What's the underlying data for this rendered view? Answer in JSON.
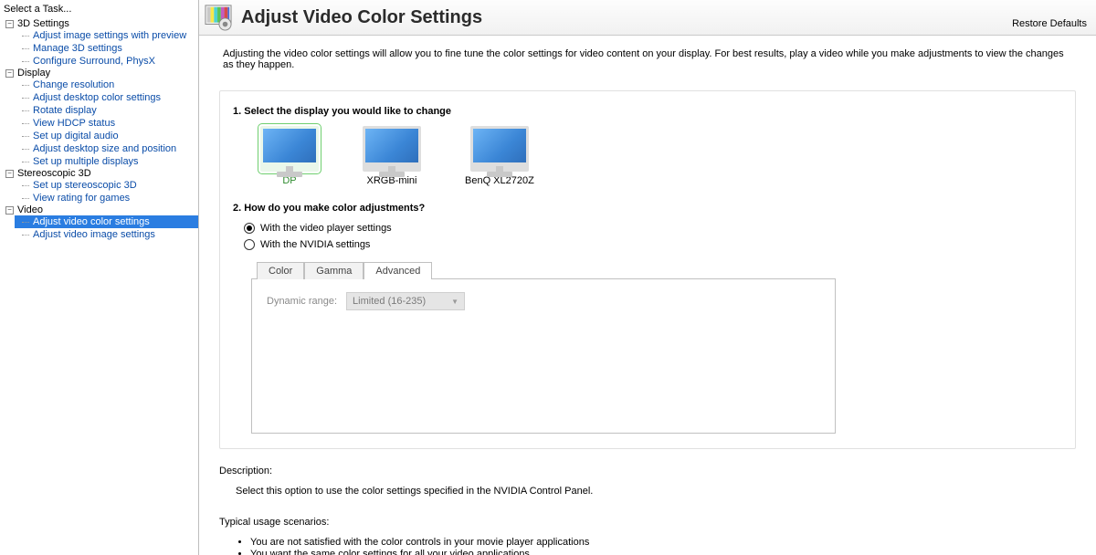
{
  "sidebar": {
    "header": "Select a Task...",
    "groups": [
      {
        "label": "3D Settings",
        "items": [
          "Adjust image settings with preview",
          "Manage 3D settings",
          "Configure Surround, PhysX"
        ]
      },
      {
        "label": "Display",
        "items": [
          "Change resolution",
          "Adjust desktop color settings",
          "Rotate display",
          "View HDCP status",
          "Set up digital audio",
          "Adjust desktop size and position",
          "Set up multiple displays"
        ]
      },
      {
        "label": "Stereoscopic 3D",
        "items": [
          "Set up stereoscopic 3D",
          "View rating for games"
        ]
      },
      {
        "label": "Video",
        "items": [
          "Adjust video color settings",
          "Adjust video image settings"
        ]
      }
    ],
    "selected": "Adjust video color settings"
  },
  "header": {
    "title": "Adjust Video Color Settings",
    "restore": "Restore Defaults"
  },
  "intro": "Adjusting the video color settings will allow you to fine tune the color settings for video content on your display. For best results, play a video while you make adjustments to view the changes as they happen.",
  "step1": {
    "label": "1. Select the display you would like to change",
    "displays": [
      {
        "name": "DP",
        "selected": true
      },
      {
        "name": "XRGB-mini",
        "selected": false
      },
      {
        "name": "BenQ XL2720Z",
        "selected": false
      }
    ]
  },
  "step2": {
    "label": "2. How do you make color adjustments?",
    "options": [
      {
        "text": "With the video player settings",
        "checked": true
      },
      {
        "text": "With the NVIDIA settings",
        "checked": false
      }
    ]
  },
  "tabs": {
    "items": [
      "Color",
      "Gamma",
      "Advanced"
    ],
    "active": "Advanced"
  },
  "advanced": {
    "dynamic_label": "Dynamic range:",
    "dynamic_value": "Limited (16-235)"
  },
  "description": {
    "title": "Description:",
    "text": "Select this option to use the color settings specified in the NVIDIA Control Panel.",
    "scen_title": "Typical usage scenarios:",
    "scenarios": [
      "You are not satisfied with the color controls in your movie player applications",
      "You want the same color settings for all your video applications"
    ]
  }
}
